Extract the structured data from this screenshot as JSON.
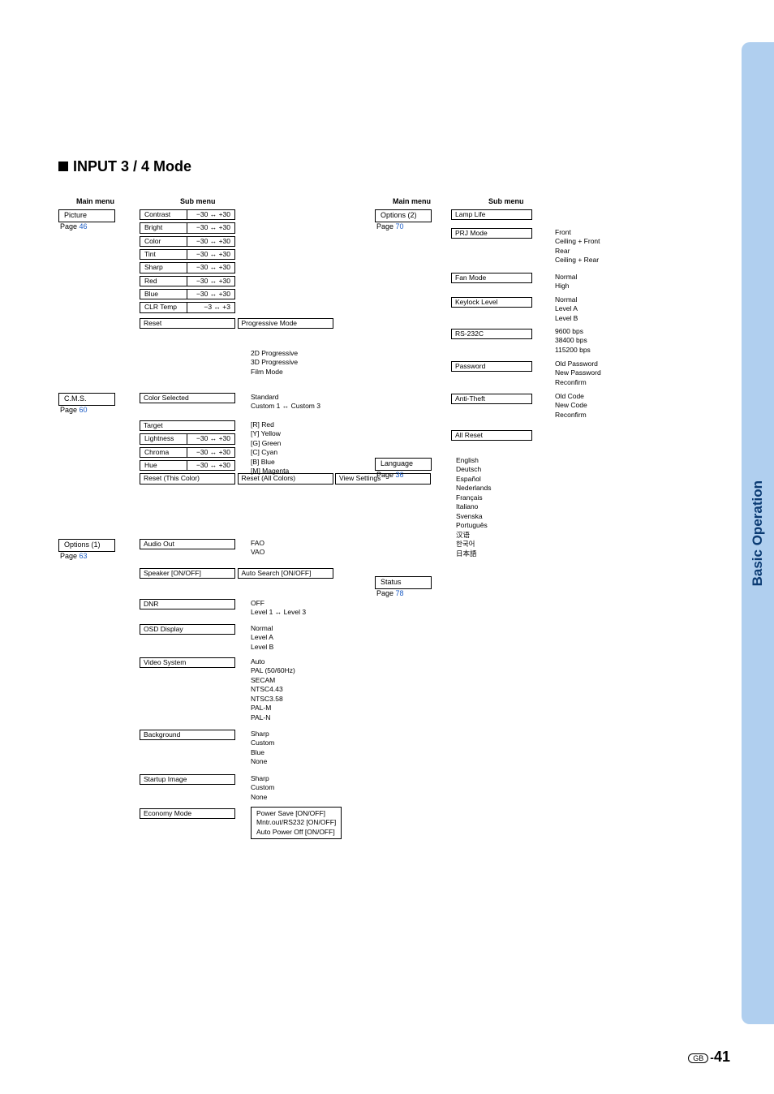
{
  "sideTab": "Basic Operation",
  "pageNumber": {
    "gb": "GB",
    "num": "41"
  },
  "title": "INPUT 3 / 4 Mode",
  "headers": {
    "main": "Main menu",
    "sub": "Sub menu"
  },
  "left": {
    "picture": {
      "label": "Picture",
      "page": "46",
      "items": [
        {
          "l": "Contrast",
          "r": "−30 ↔ +30"
        },
        {
          "l": "Bright",
          "r": "−30 ↔ +30"
        },
        {
          "l": "Color",
          "r": "−30 ↔ +30"
        },
        {
          "l": "Tint",
          "r": "−30 ↔ +30"
        },
        {
          "l": "Sharp",
          "r": "−30 ↔ +30"
        },
        {
          "l": "Red",
          "r": "−30 ↔ +30"
        },
        {
          "l": "Blue",
          "r": "−30 ↔ +30"
        },
        {
          "l": "CLR Temp",
          "r": "−3 ↔ +3"
        }
      ],
      "reset": "Reset",
      "prog": "Progressive Mode",
      "progSub": "2D Progressive\n3D Progressive\nFilm Mode"
    },
    "cms": {
      "label": "C.M.S.",
      "page": "60",
      "colorSelected": "Color Selected",
      "colorSelectedSub": "Standard\nCustom 1 ↔ Custom 3",
      "target": "Target",
      "targetSub": "[R] Red\n[Y] Yellow\n[G] Green\n[C] Cyan\n[B] Blue\n[M] Magenta",
      "lch": [
        {
          "l": "Lightness",
          "r": "−30 ↔ +30"
        },
        {
          "l": "Chroma",
          "r": "−30 ↔ +30"
        },
        {
          "l": "Hue",
          "r": "−30 ↔ +30"
        }
      ],
      "resetThis": "Reset (This Color)",
      "resetAll": "Reset (All Colors)",
      "view": "View Settings"
    },
    "options1": {
      "label": "Options (1)",
      "page": "63",
      "audioOut": "Audio Out",
      "audioOutSub": "FAO\nVAO",
      "speaker": "Speaker [ON/OFF]",
      "autoSearch": "Auto Search [ON/OFF]",
      "dnr": "DNR",
      "dnrSub": "OFF\nLevel 1 ↔ Level 3",
      "osd": "OSD Display",
      "osdSub": "Normal\nLevel A\nLevel B",
      "video": "Video System",
      "videoSub": "Auto\nPAL (50/60Hz)\nSECAM\nNTSC4.43\nNTSC3.58\nPAL-M\nPAL-N",
      "bg": "Background",
      "bgSub": "Sharp\nCustom\nBlue\nNone",
      "startup": "Startup Image",
      "startupSub": "Sharp\nCustom\nNone",
      "eco": "Economy Mode",
      "ecoSub": "Power Save [ON/OFF]\nMntr.out/RS232 [ON/OFF]\nAuto Power Off [ON/OFF]"
    }
  },
  "right": {
    "options2": {
      "label": "Options (2)",
      "page": "70",
      "lamp": "Lamp Life",
      "prj": "PRJ Mode",
      "prjSub": "Front\nCeiling + Front\nRear\nCeiling + Rear",
      "fan": "Fan Mode",
      "fanSub": "Normal\nHigh",
      "key": "Keylock Level",
      "keySub": "Normal\nLevel A\nLevel B",
      "rs": "RS-232C",
      "rsSub": "9600 bps\n38400 bps\n115200 bps",
      "pw": "Password",
      "pwSub": "Old Password\nNew Password\nReconfirm",
      "anti": "Anti-Theft",
      "antiSub": "Old Code\nNew Code\nReconfirm",
      "allReset": "All Reset"
    },
    "language": {
      "label": "Language",
      "page": "36",
      "list": "English\nDeutsch\nEspañol\nNederlands\nFrançais\nItaliano\nSvenska\nPortuguês\n汉语\n한국어\n日本語"
    },
    "status": {
      "label": "Status",
      "page": "78"
    }
  }
}
